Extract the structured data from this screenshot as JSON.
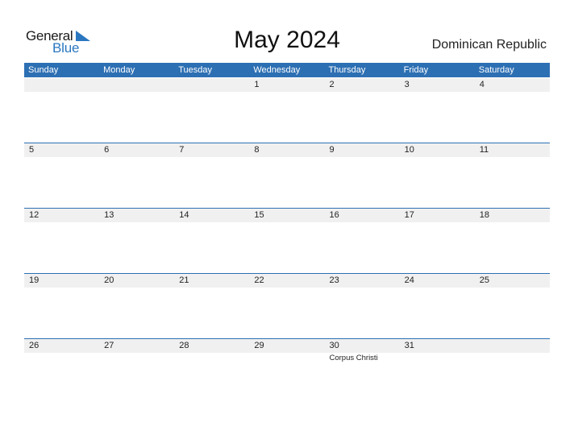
{
  "logo": {
    "line1": "General",
    "line2": "Blue"
  },
  "title": "May 2024",
  "country": "Dominican Republic",
  "weekdays": [
    "Sunday",
    "Monday",
    "Tuesday",
    "Wednesday",
    "Thursday",
    "Friday",
    "Saturday"
  ],
  "weeks": [
    {
      "days": [
        "",
        "",
        "",
        "1",
        "2",
        "3",
        "4"
      ],
      "events": [
        "",
        "",
        "",
        "",
        "",
        "",
        ""
      ]
    },
    {
      "days": [
        "5",
        "6",
        "7",
        "8",
        "9",
        "10",
        "11"
      ],
      "events": [
        "",
        "",
        "",
        "",
        "",
        "",
        ""
      ]
    },
    {
      "days": [
        "12",
        "13",
        "14",
        "15",
        "16",
        "17",
        "18"
      ],
      "events": [
        "",
        "",
        "",
        "",
        "",
        "",
        ""
      ]
    },
    {
      "days": [
        "19",
        "20",
        "21",
        "22",
        "23",
        "24",
        "25"
      ],
      "events": [
        "",
        "",
        "",
        "",
        "",
        "",
        ""
      ]
    },
    {
      "days": [
        "26",
        "27",
        "28",
        "29",
        "30",
        "31",
        ""
      ],
      "events": [
        "",
        "",
        "",
        "",
        "Corpus Christi",
        "",
        ""
      ]
    }
  ],
  "colors": {
    "accent": "#2d6fb3",
    "logo_blue": "#2a77c0",
    "strip": "#f0f0f0"
  }
}
